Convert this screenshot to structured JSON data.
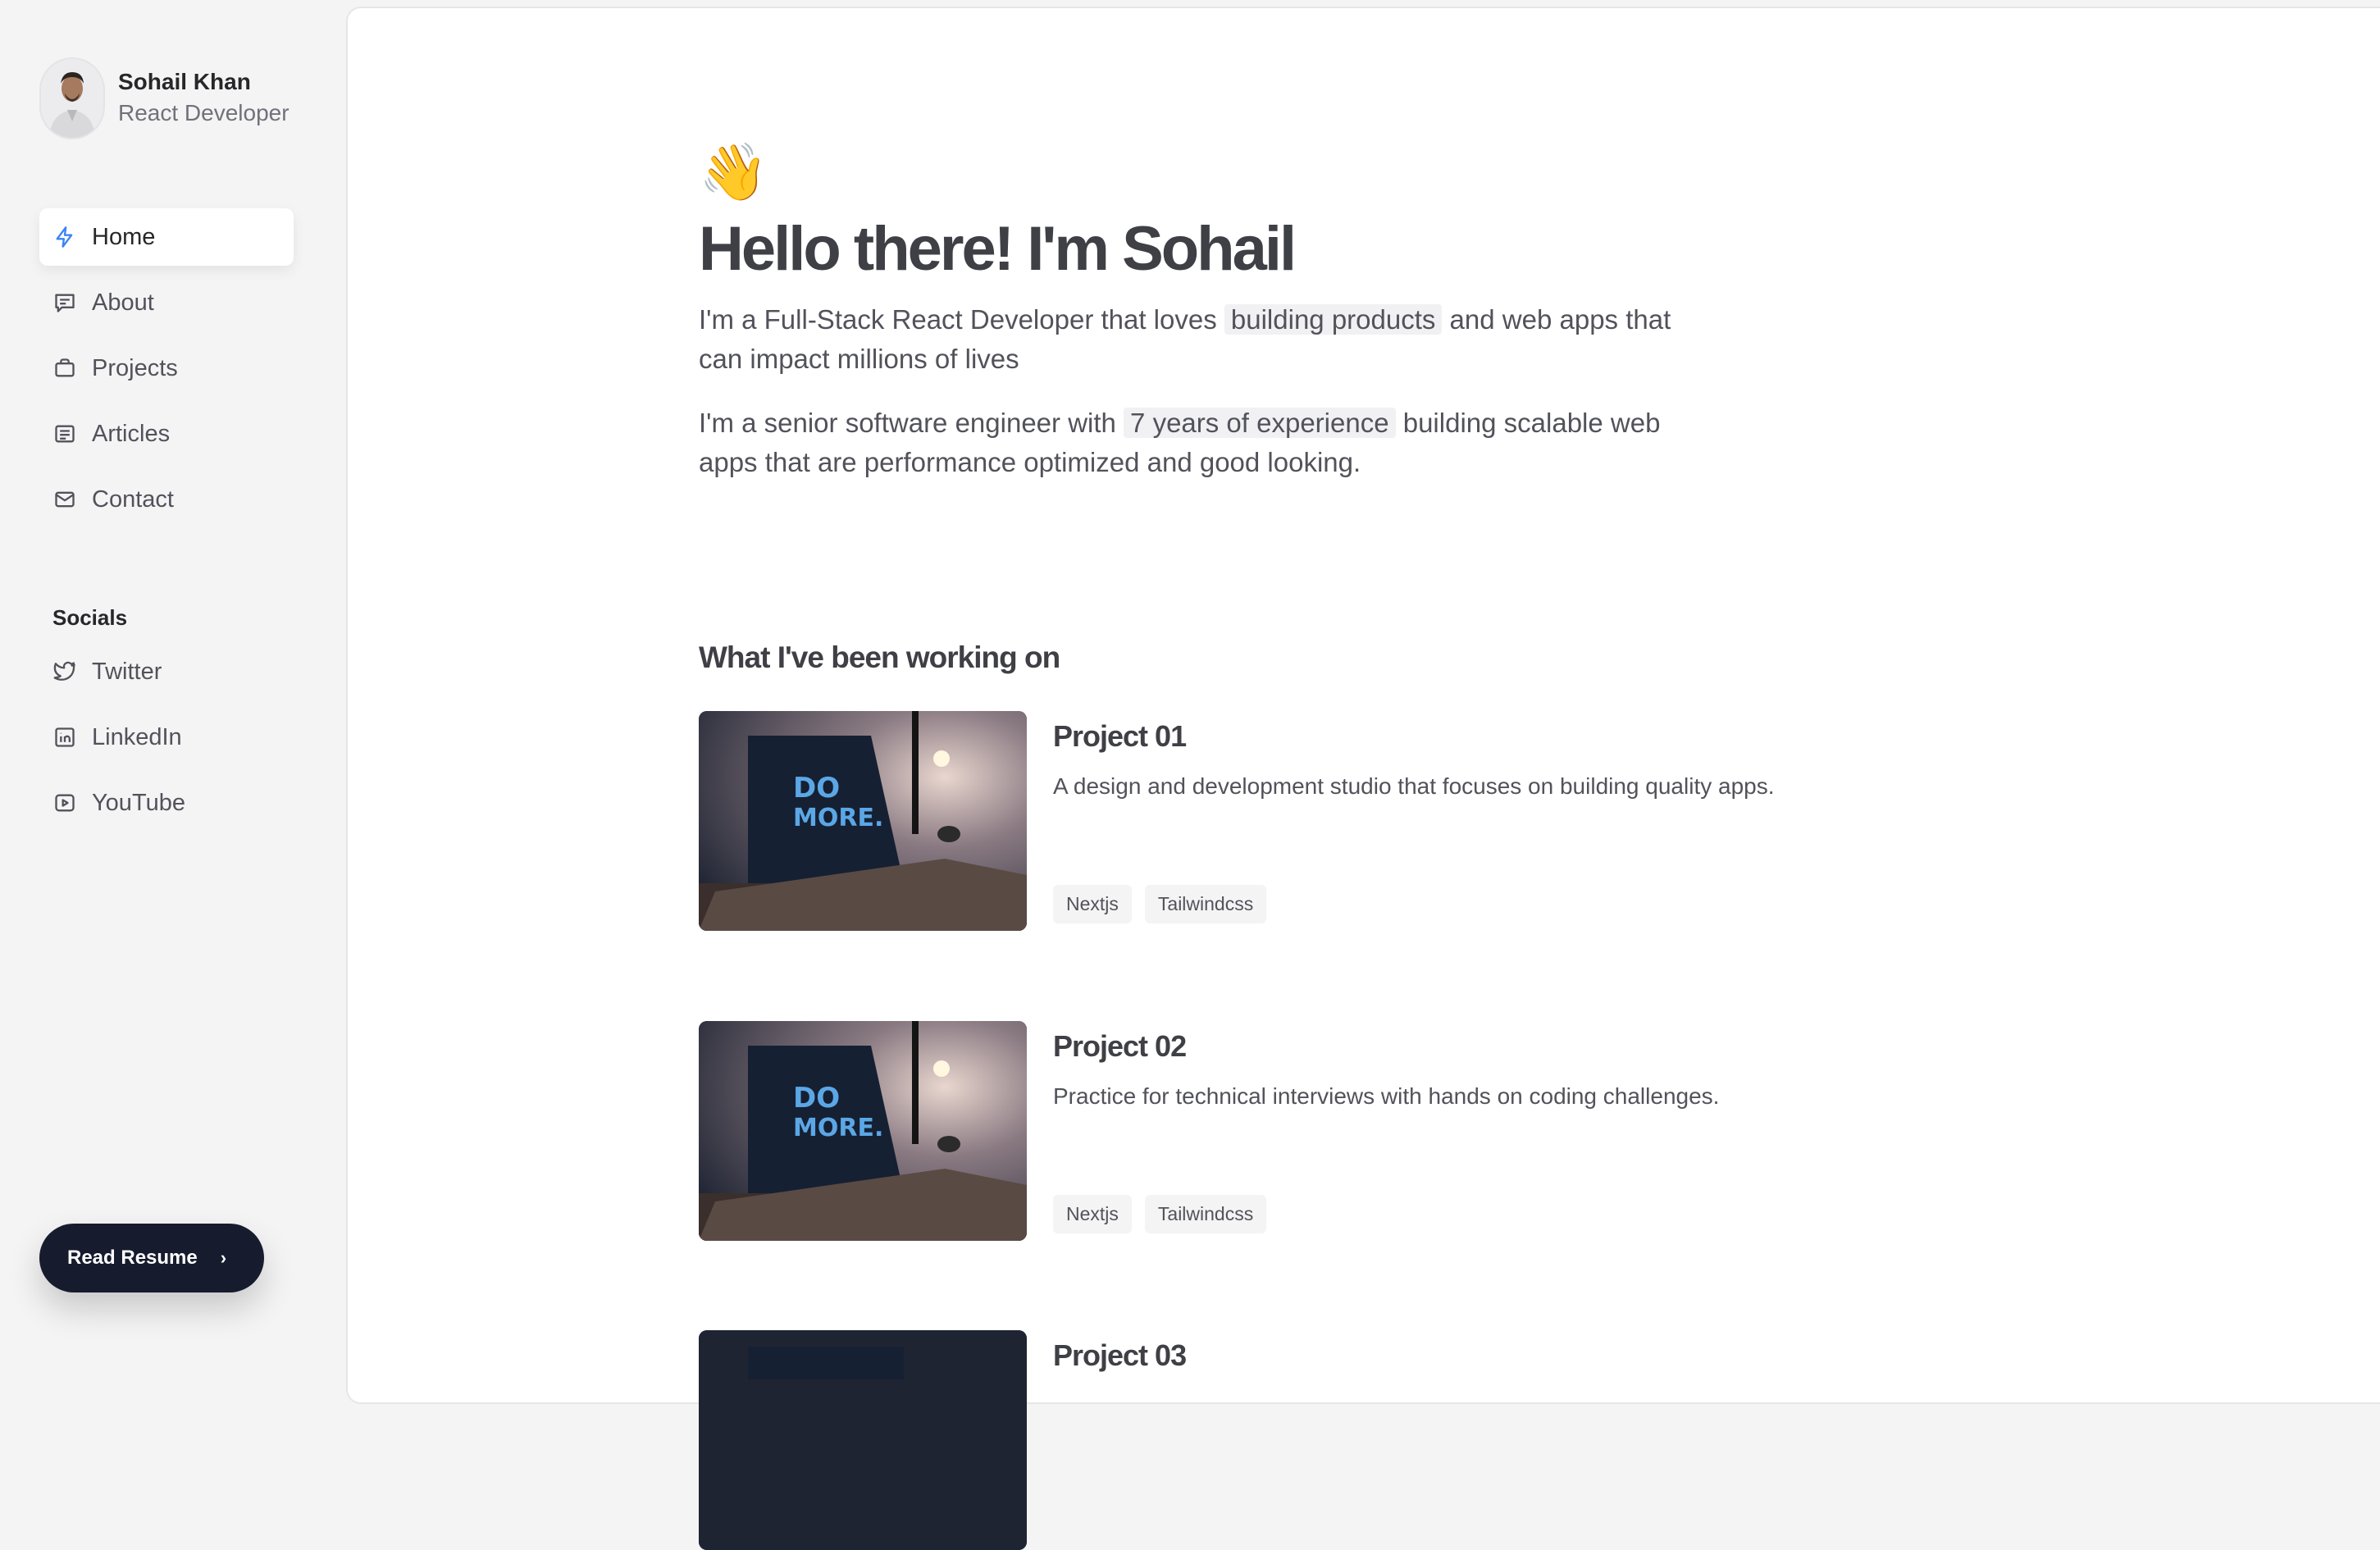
{
  "profile": {
    "name": "Sohail Khan",
    "role": "React Developer"
  },
  "nav": {
    "items": [
      {
        "label": "Home",
        "icon": "lightning-icon",
        "active": true
      },
      {
        "label": "About",
        "icon": "message-icon",
        "active": false
      },
      {
        "label": "Projects",
        "icon": "briefcase-icon",
        "active": false
      },
      {
        "label": "Articles",
        "icon": "list-icon",
        "active": false
      },
      {
        "label": "Contact",
        "icon": "mail-icon",
        "active": false
      }
    ]
  },
  "socials": {
    "title": "Socials",
    "items": [
      {
        "label": "Twitter",
        "icon": "twitter-icon"
      },
      {
        "label": "LinkedIn",
        "icon": "linkedin-icon"
      },
      {
        "label": "YouTube",
        "icon": "youtube-icon"
      }
    ]
  },
  "resume_button": {
    "label": "Read Resume",
    "chevron": "›"
  },
  "hero": {
    "emoji": "👋",
    "heading": "Hello there! I'm Sohail",
    "p1_before": "I'm a Full-Stack React Developer that loves ",
    "p1_highlight": "building products",
    "p1_after": " and web apps that can impact millions of lives",
    "p2_before": "I'm a senior software engineer with ",
    "p2_highlight": "7 years of experience",
    "p2_after": " building scalable web apps that are performance optimized and good looking."
  },
  "work": {
    "title": "What I've been working on",
    "projects": [
      {
        "title": "Project 01",
        "description": "A design and development studio that focuses on building quality apps.",
        "tags": [
          "Nextjs",
          "Tailwindcss"
        ],
        "image_text": [
          "DO",
          "MORE."
        ]
      },
      {
        "title": "Project 02",
        "description": "Practice for technical interviews with hands on coding challenges.",
        "tags": [
          "Nextjs",
          "Tailwindcss"
        ],
        "image_text": [
          "DO",
          "MORE."
        ]
      },
      {
        "title": "Project 03"
      }
    ]
  },
  "colors": {
    "accent": "#3b82f6",
    "resume_bg": "#171b2e",
    "sidebar_bg": "#f4f4f5"
  }
}
